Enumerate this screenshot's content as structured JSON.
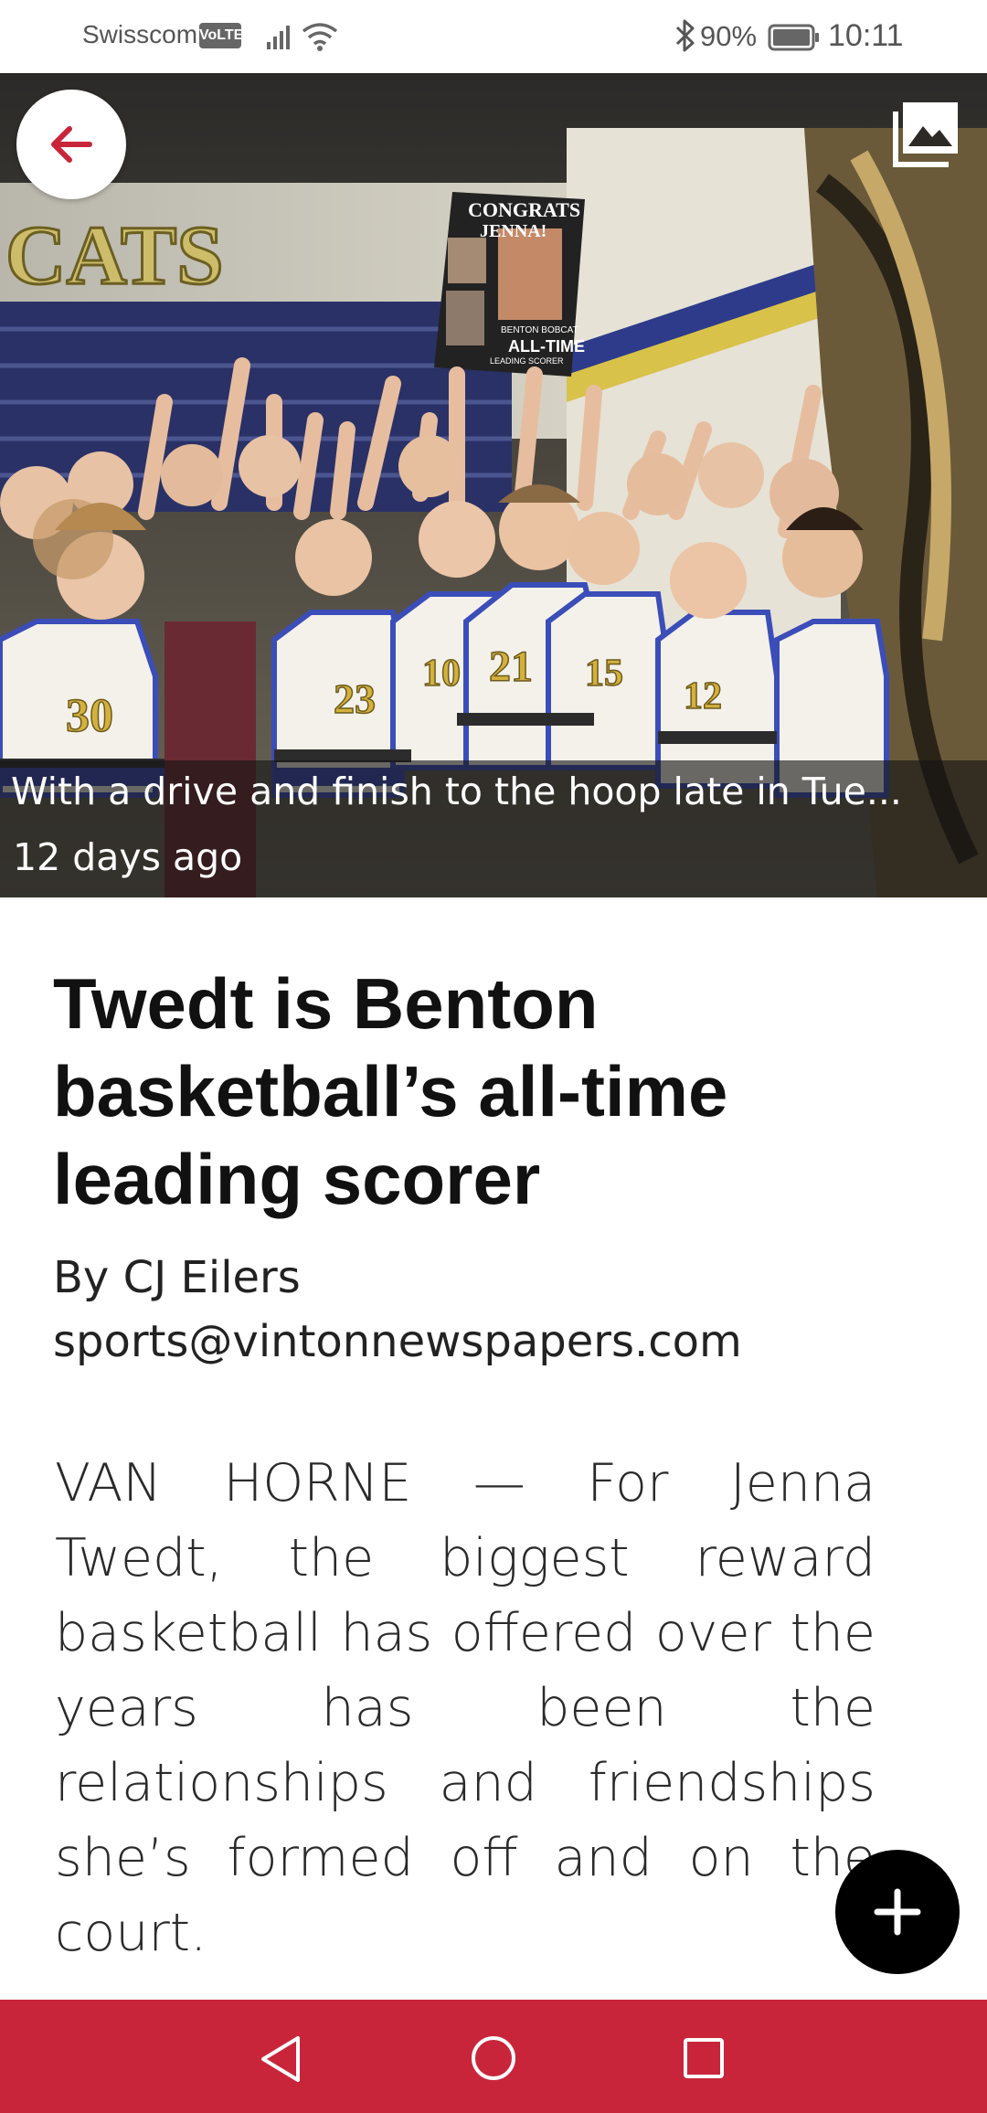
{
  "status_bar": {
    "carrier": "Swisscom",
    "volte": "VoLTE",
    "battery_percent": "90%",
    "time": "10:11"
  },
  "hero": {
    "caption": "With a drive and finish to the hoop late in Tue...",
    "date": "12 days ago",
    "sign_lines": [
      "CONGRATS",
      "JENNA!",
      "BENTON BOBCAT",
      "ALL-TIME",
      "LEADING SCORER"
    ],
    "wall_text": "CATS",
    "jersey_numbers": [
      "30",
      "23",
      "10",
      "21",
      "15",
      "12"
    ]
  },
  "article": {
    "title": "Twedt is Benton basketball’s all-time leading scorer",
    "byline": "By CJ Eilers",
    "email": "sports@vintonnewspapers.com",
    "body": "VAN HORNE — For Jenna Twedt, the biggest reward basketball has offered over the years has been the relationships and friendships she’s formed off and on the court."
  },
  "colors": {
    "accent": "#c8253b",
    "fab": "#000000",
    "caption_overlay": "#141414"
  },
  "icons": {
    "back": "arrow-left-icon",
    "gallery": "image-gallery-icon",
    "fab": "plus-icon",
    "nav_back": "triangle-back-icon",
    "nav_home": "circle-home-icon",
    "nav_recents": "square-recents-icon"
  }
}
